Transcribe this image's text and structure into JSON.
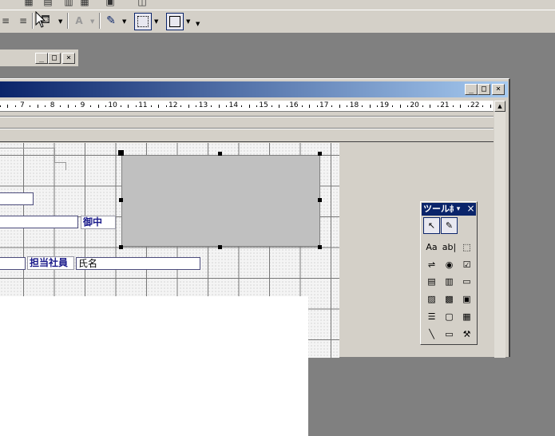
{
  "toolbar": {
    "fill_color_label": "fill-color",
    "font_color_glyph": "A",
    "icons": [
      "align-center-icon",
      "align-right-icon",
      "fill-color-icon",
      "font-color-icon",
      "line-color-icon",
      "border-icon",
      "line-style-icon"
    ]
  },
  "back_window": {
    "controls": {
      "minimize": "_",
      "restore": "□",
      "close": "×"
    }
  },
  "main_window": {
    "controls": {
      "minimize": "_",
      "restore": "□",
      "close": "×"
    },
    "ruler_numbers": [
      "7",
      "8",
      "9",
      "10",
      "11",
      "12",
      "13",
      "14",
      "15",
      "16",
      "17",
      "18",
      "19",
      "20",
      "21",
      "22"
    ]
  },
  "form": {
    "label_onchu": "御中",
    "label_tanto": "担当社員",
    "field_name": "氏名"
  },
  "toolbox": {
    "title": "ツールﾎﾞ",
    "title_arrow": "▾",
    "close": "×",
    "tools": [
      {
        "name": "select-objects-tool",
        "glyph": "↖",
        "selected": true
      },
      {
        "name": "control-wizard-tool",
        "glyph": "✎",
        "selected": true
      },
      {
        "name": "label-tool",
        "glyph": "Aa",
        "selected": false
      },
      {
        "name": "textbox-tool",
        "glyph": "ab|",
        "selected": false
      },
      {
        "name": "option-group-tool",
        "glyph": "⬚",
        "selected": false
      },
      {
        "name": "toggle-button-tool",
        "glyph": "⇌",
        "selected": false
      },
      {
        "name": "option-button-tool",
        "glyph": "◉",
        "selected": false
      },
      {
        "name": "check-box-tool",
        "glyph": "☑",
        "selected": false
      },
      {
        "name": "combo-box-tool",
        "glyph": "▤",
        "selected": false
      },
      {
        "name": "list-box-tool",
        "glyph": "▥",
        "selected": false
      },
      {
        "name": "command-button-tool",
        "glyph": "▭",
        "selected": false
      },
      {
        "name": "image-tool",
        "glyph": "▨",
        "selected": false
      },
      {
        "name": "unbound-object-frame-tool",
        "glyph": "▩",
        "selected": false
      },
      {
        "name": "bound-object-frame-tool",
        "glyph": "▣",
        "selected": false
      },
      {
        "name": "page-break-tool",
        "glyph": "☰",
        "selected": false
      },
      {
        "name": "tab-control-tool",
        "glyph": "▢",
        "selected": false
      },
      {
        "name": "subform-tool",
        "glyph": "▦",
        "selected": false
      },
      {
        "name": "line-tool",
        "glyph": "╲",
        "selected": false
      },
      {
        "name": "rectangle-tool",
        "glyph": "▭",
        "selected": false
      },
      {
        "name": "more-controls-tool",
        "glyph": "⚒",
        "selected": false
      }
    ]
  }
}
